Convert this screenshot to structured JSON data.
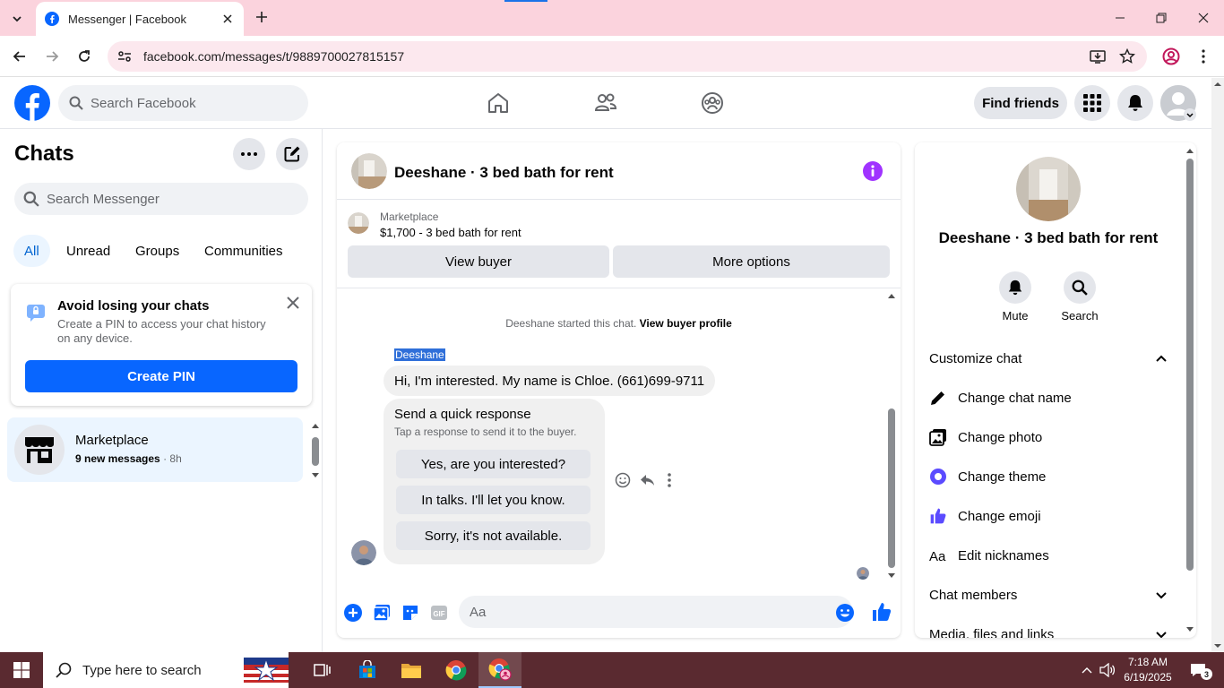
{
  "browser": {
    "tab_title": "Messenger | Facebook",
    "url": "facebook.com/messages/t/9889700027815157"
  },
  "fb_header": {
    "search_placeholder": "Search Facebook",
    "find_friends": "Find friends"
  },
  "sidebar": {
    "title": "Chats",
    "search_placeholder": "Search Messenger",
    "filters": [
      "All",
      "Unread",
      "Groups",
      "Communities"
    ],
    "pin_card": {
      "title": "Avoid losing your chats",
      "description": "Create a PIN to access your chat history on any device.",
      "button": "Create PIN"
    },
    "conversation": {
      "name": "Marketplace",
      "unread": "9 new messages",
      "separator": " · ",
      "time": "8h"
    }
  },
  "chat": {
    "title": "Deeshane · 3 bed bath for rent",
    "marketplace_label": "Marketplace",
    "listing": "$1,700 - 3 bed bath for rent",
    "view_buyer": "View buyer",
    "more_options": "More options",
    "system_message": "Deeshane started this chat.",
    "system_link": "View buyer profile",
    "sender_name": "Deeshane",
    "message": "Hi, I'm interested. My name is Chloe. (661)699-9711",
    "quick_response": {
      "title": "Send a quick response",
      "hint": "Tap a response to send it to the buyer.",
      "options": [
        "Yes, are you interested?",
        "In talks. I'll let you know.",
        "Sorry, it's not available."
      ]
    },
    "composer_placeholder": "Aa"
  },
  "right_panel": {
    "name": "Deeshane · 3 bed bath for rent",
    "mute": "Mute",
    "search": "Search",
    "customize_chat": "Customize chat",
    "items": [
      "Change chat name",
      "Change photo",
      "Change theme",
      "Change emoji",
      "Edit nicknames"
    ],
    "chat_members": "Chat members",
    "media": "Media, files and links"
  },
  "taskbar": {
    "search_placeholder": "Type here to search",
    "time": "7:18 AM",
    "date": "6/19/2025",
    "notifications": "3"
  },
  "colors": {
    "accent": "#0866ff",
    "theme": "#7a3cff"
  }
}
